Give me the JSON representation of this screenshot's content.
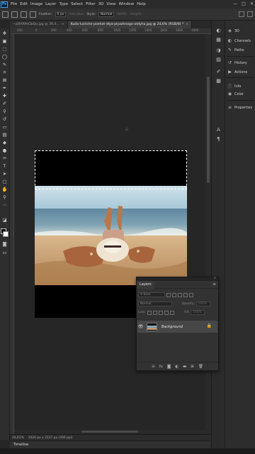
{
  "app_logo": "Ps",
  "menu": [
    "File",
    "Edit",
    "Image",
    "Layer",
    "Type",
    "Select",
    "Filter",
    "3D",
    "View",
    "Window",
    "Help"
  ],
  "window_controls": [
    "—",
    "□",
    "✕"
  ],
  "options": {
    "feather_label": "Feather:",
    "feather_value": "0 px",
    "anti_alias": "Anti-alias",
    "style_label": "Style:",
    "style_value": "Normal",
    "width_label": "Width:",
    "height_label": "Height:",
    "select_mask": "Select and Mask..."
  },
  "tabs": [
    {
      "label": "~zjfiARPeGbQo.jpg @ 39,4..."
    },
    {
      "label": "Kuda-luchshe-poehat-dlya-plyazhnogo-otdyha.jpg @ 24,6% (RGB/8) *"
    }
  ],
  "ruler_ticks": [
    "200",
    "0",
    "200",
    "400",
    "600",
    "800",
    "1000",
    "1200",
    "1400",
    "1600",
    "1800",
    "2000"
  ],
  "status": {
    "zoom": "24,61%",
    "doc_info": "1920 px x 2127 px (300 ppi)"
  },
  "timeline_label": "Timeline",
  "right_panels": [
    {
      "icon": "3d-icon",
      "glyph": "◈",
      "label": "3D"
    },
    {
      "icon": "channels-icon",
      "glyph": "◐",
      "label": "Channels"
    },
    {
      "icon": "paths-icon",
      "glyph": "✎",
      "label": "Paths"
    },
    {
      "icon": "history-icon",
      "glyph": "↺",
      "label": "History"
    },
    {
      "icon": "actions-icon",
      "glyph": "▶",
      "label": "Actions"
    },
    {
      "icon": "info-icon",
      "glyph": "ⓘ",
      "label": "Info"
    },
    {
      "icon": "color-icon",
      "glyph": "◉",
      "label": "Color"
    },
    {
      "icon": "properties-icon",
      "glyph": "≡",
      "label": "Properties"
    }
  ],
  "layers_panel": {
    "title": "Layers",
    "search_placeholder": "Kind",
    "blend_mode": "Normal",
    "opacity_label": "Opacity:",
    "opacity_value": "100%",
    "lock_label": "Lock:",
    "fill_label": "Fill:",
    "fill_value": "100%",
    "layers": [
      {
        "name": "Background",
        "visible": true,
        "locked": true
      }
    ]
  },
  "colors": {
    "accent": "#31a8ff",
    "foreground_swatch": "#000000",
    "background_swatch": "#ffffff"
  }
}
